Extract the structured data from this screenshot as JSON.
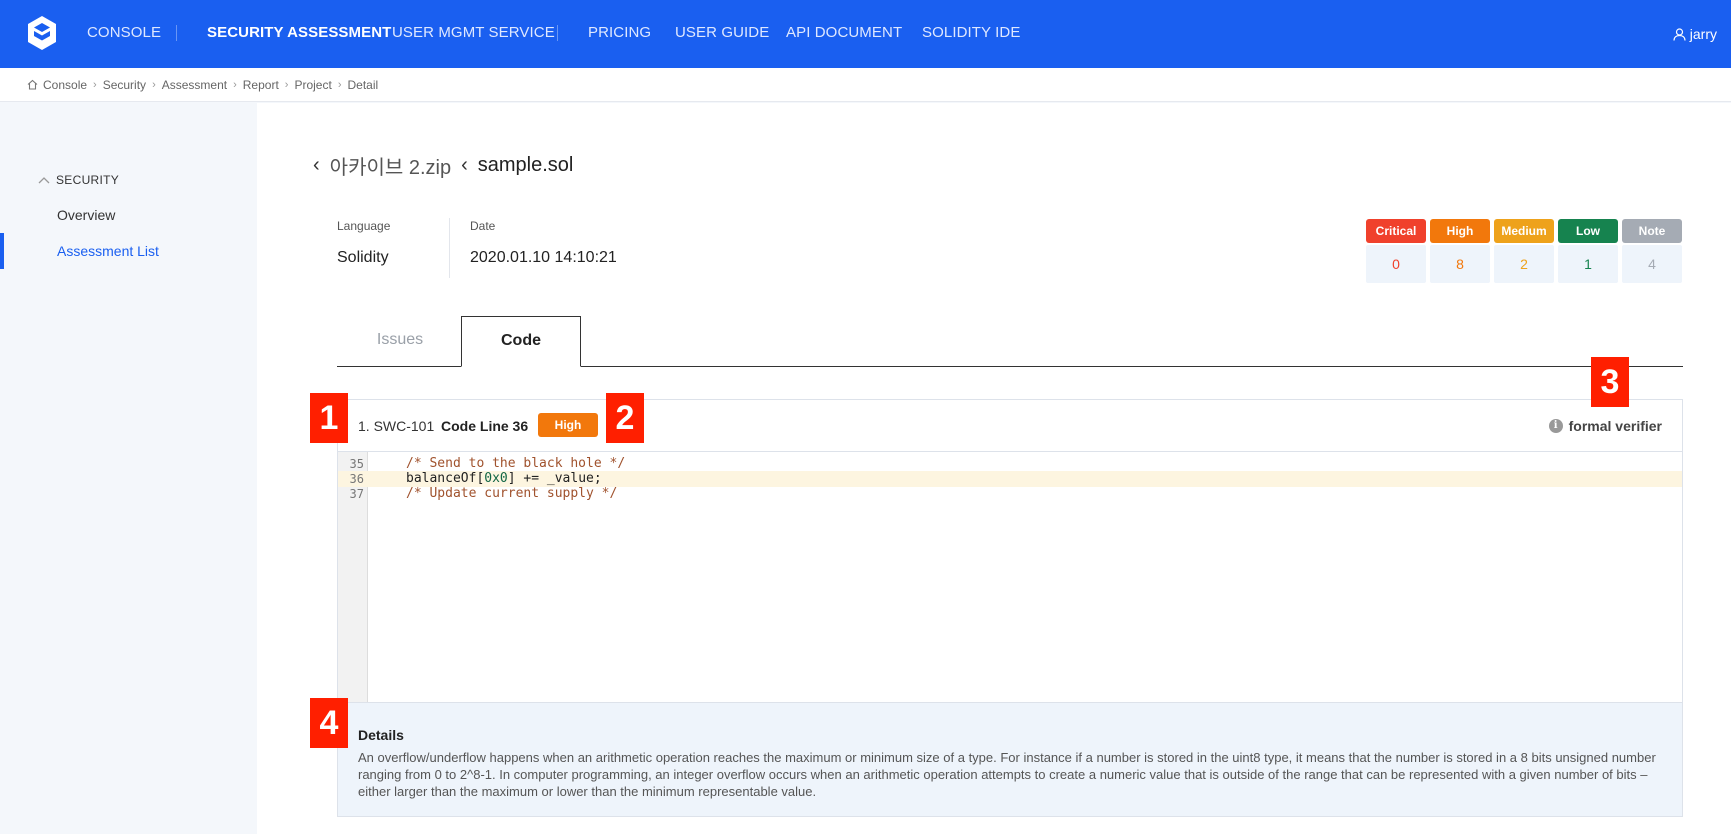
{
  "nav": {
    "items": [
      "CONSOLE",
      "SECURITY ASSESSMENT",
      "USER MGMT SERVICE",
      "PRICING",
      "USER GUIDE",
      "API DOCUMENT",
      "SOLIDITY IDE"
    ],
    "user": "jarry"
  },
  "breadcrumb": [
    "Console",
    "Security",
    "Assessment",
    "Report",
    "Project",
    "Detail"
  ],
  "sidebar": {
    "section": "SECURITY",
    "items": [
      "Overview",
      "Assessment List"
    ]
  },
  "title": {
    "parent": "아카이브 2.zip",
    "file": "sample.sol"
  },
  "meta": {
    "language_label": "Language",
    "language_value": "Solidity",
    "date_label": "Date",
    "date_value": "2020.01.10 14:10:21"
  },
  "severity": [
    {
      "label": "Critical",
      "count": "0",
      "color": "#f0412c"
    },
    {
      "label": "High",
      "count": "8",
      "color": "#f2780c"
    },
    {
      "label": "Medium",
      "count": "2",
      "color": "#eea21b"
    },
    {
      "label": "Low",
      "count": "1",
      "color": "#16834f"
    },
    {
      "label": "Note",
      "count": "4",
      "color": "#a5abb4"
    }
  ],
  "tabs": [
    "Issues",
    "Code"
  ],
  "issue": {
    "id": "1. SWC-101",
    "code_line": "Code Line 36",
    "severity": "High",
    "verifier": "formal verifier"
  },
  "code": {
    "lines": [
      {
        "no": "35",
        "text": "/* Send to the black hole */"
      },
      {
        "no": "36",
        "pre": "balanceOf[",
        "num": "0x0",
        "post": "] += _value;"
      },
      {
        "no": "37",
        "text": "/* Update current supply */"
      }
    ]
  },
  "details": {
    "title": "Details",
    "text": "An overflow/underflow happens when an arithmetic operation reaches the maximum or minimum size of a type. For instance if a number is stored in the uint8 type, it means that the number is stored in a 8 bits unsigned number ranging from 0 to 2^8-1. In computer programming, an integer overflow occurs when an arithmetic operation attempts to create a numeric value that is outside of the range that can be represented with a given number of bits – either larger than the maximum or lower than the minimum representable value."
  },
  "markers": [
    "1",
    "2",
    "3",
    "4"
  ]
}
